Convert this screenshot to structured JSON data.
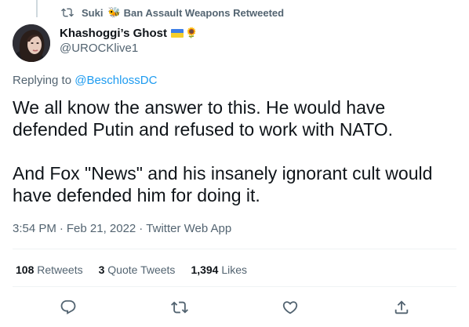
{
  "retweet": {
    "icon": "retweet-icon",
    "user": "Suki",
    "badge_icon": "bee-icon",
    "text": "Ban Assault Weapons Retweeted"
  },
  "author": {
    "name": "Khashoggi’s Ghost",
    "handle": "@UROCKlive1",
    "badges": [
      "ukraine-flag-icon",
      "sunflower-icon"
    ]
  },
  "reply": {
    "prefix": "Replying to",
    "mention": "@BeschlossDC"
  },
  "tweet": {
    "paragraphs": [
      "We all know the answer to this. He would have defended Putin and refused to work with NATO.",
      "And Fox \"News\" and his insanely ignorant cult would have defended him for doing it."
    ]
  },
  "meta": {
    "time": "3:54 PM",
    "date": "Feb 21, 2022",
    "source": "Twitter Web App",
    "separator": "·"
  },
  "stats": {
    "retweets_count": "108",
    "retweets_label": "Retweets",
    "quotes_count": "3",
    "quotes_label": "Quote Tweets",
    "likes_count": "1,394",
    "likes_label": "Likes"
  },
  "actions": [
    "reply-icon",
    "retweet-icon",
    "like-icon",
    "share-icon"
  ],
  "colors": {
    "text": "#0f1419",
    "secondary": "#536471",
    "link": "#1d9bf0",
    "divider": "#eff3f4"
  }
}
